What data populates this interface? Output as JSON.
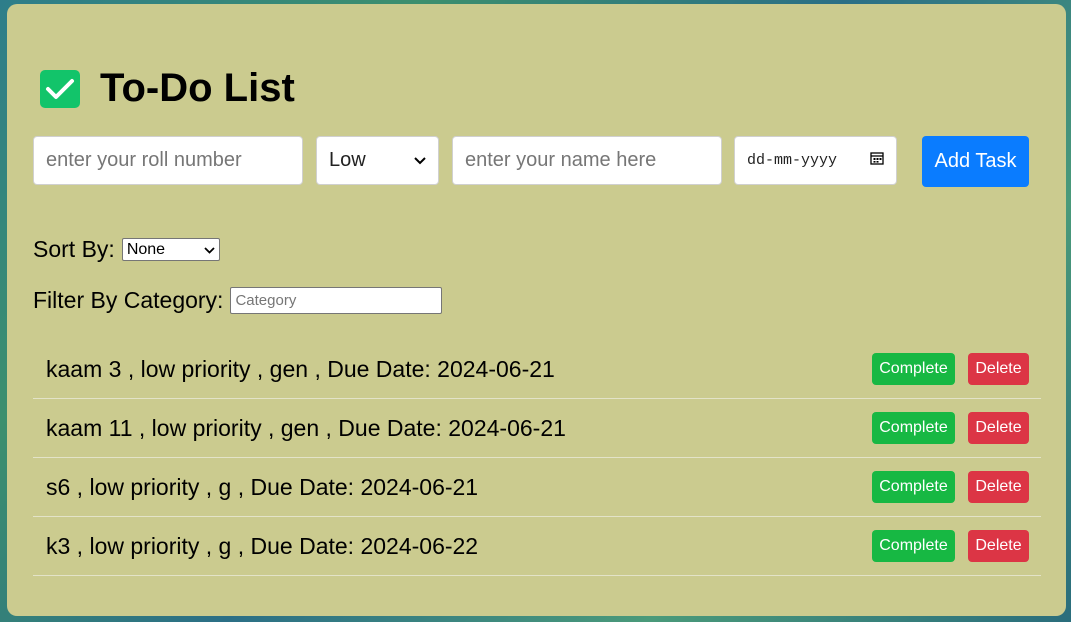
{
  "header": {
    "title": "To-Do List",
    "icon": "checkbox-icon"
  },
  "form": {
    "roll_placeholder": "enter your roll number",
    "priority_value": "Low",
    "name_placeholder": "enter your name here",
    "date_placeholder": "dd-mm-yyyy",
    "add_label": "Add Task"
  },
  "sort": {
    "label": "Sort By:",
    "value": "None"
  },
  "filter": {
    "label": "Filter By Category:",
    "placeholder": "Category"
  },
  "tasks": [
    {
      "text": "kaam 3 , low priority , gen , Due Date: 2024-06-21",
      "complete_label": "Complete",
      "delete_label": "Delete"
    },
    {
      "text": "kaam 11 , low priority , gen , Due Date: 2024-06-21",
      "complete_label": "Complete",
      "delete_label": "Delete"
    },
    {
      "text": "s6 , low priority , g , Due Date: 2024-06-21",
      "complete_label": "Complete",
      "delete_label": "Delete"
    },
    {
      "text": "k3 , low priority , g , Due Date: 2024-06-22",
      "complete_label": "Complete",
      "delete_label": "Delete"
    }
  ],
  "colors": {
    "card": "#cbcb8f",
    "accent": "#0a7cff",
    "complete": "#17b843",
    "delete": "#dc3545",
    "check": "#12c46a"
  }
}
